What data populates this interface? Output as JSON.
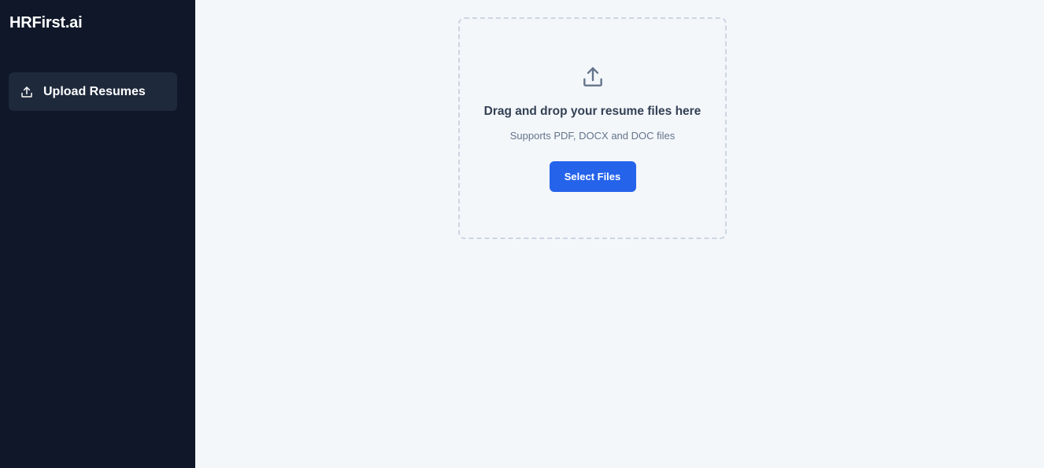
{
  "sidebar": {
    "brand": "HRFirst.ai",
    "items": [
      {
        "label": "Upload Resumes",
        "icon": "upload-icon",
        "active": true
      }
    ]
  },
  "dropzone": {
    "icon": "upload-icon",
    "title": "Drag and drop your resume files here",
    "subtitle": "Supports PDF, DOCX and DOC files",
    "button_label": "Select Files"
  },
  "colors": {
    "sidebar_bg": "#0f1729",
    "nav_active_bg": "#1e293b",
    "main_bg": "#f4f7fa",
    "accent": "#2563eb",
    "dropzone_border": "#cbd5e1"
  }
}
